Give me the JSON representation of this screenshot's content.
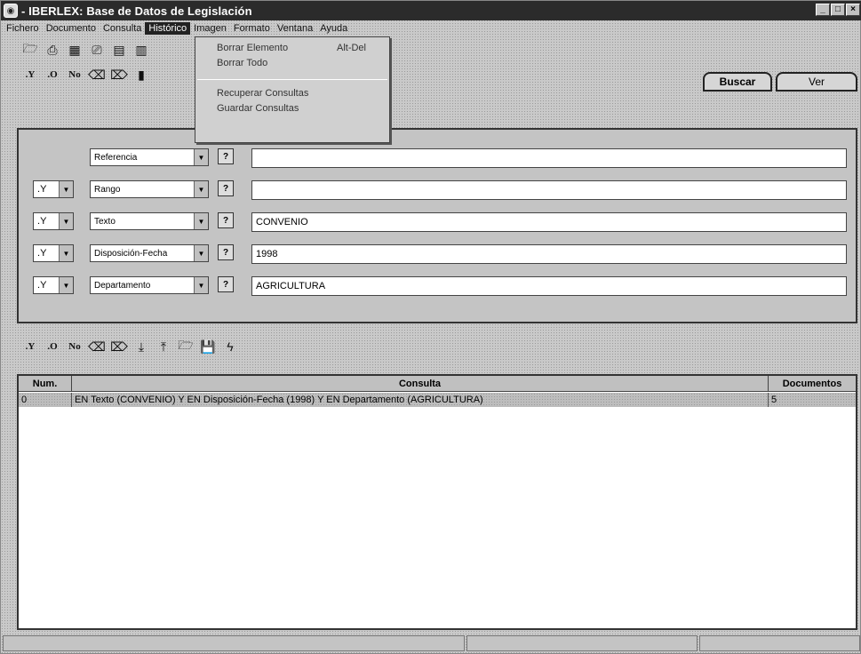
{
  "window": {
    "title": "- IBERLEX: Base de Datos de Legislación",
    "controls": [
      "_",
      "□",
      "×"
    ]
  },
  "menubar": {
    "items": [
      "Fichero",
      "Documento",
      "Consulta",
      "Histórico",
      "Imagen",
      "Formato",
      "Ventana",
      "Ayuda"
    ],
    "active": "Histórico"
  },
  "history_menu": {
    "items": [
      {
        "label": "Borrar Elemento",
        "shortcut": "Alt-Del"
      },
      {
        "label": "Borrar Todo",
        "shortcut": ""
      },
      {
        "label": "Recuperar Consultas",
        "shortcut": ""
      },
      {
        "label": "Guardar Consultas",
        "shortcut": ""
      }
    ]
  },
  "toolbar_top": {
    "row2_ops": [
      "Y",
      "O",
      "No"
    ]
  },
  "tabs": {
    "buscar": "Buscar",
    "ver": "Ver"
  },
  "query_rows": [
    {
      "operator": "",
      "field": "Referencia",
      "value": ""
    },
    {
      "operator": "Y",
      "field": "Rango",
      "value": ""
    },
    {
      "operator": "Y",
      "field": "Texto",
      "value": "CONVENIO"
    },
    {
      "operator": "Y",
      "field": "Disposición-Fecha",
      "value": "1998"
    },
    {
      "operator": "Y",
      "field": "Departamento",
      "value": "AGRICULTURA"
    }
  ],
  "toolbar_bottom": {
    "ops": [
      "Y",
      "O",
      "No"
    ]
  },
  "results": {
    "columns": [
      "Num.",
      "Consulta",
      "Documentos"
    ],
    "rows": [
      {
        "num": "0",
        "consulta": "EN Texto (CONVENIO) Y EN Disposición-Fecha (1998) Y EN Departamento (AGRICULTURA)",
        "documentos": "5"
      }
    ]
  },
  "colors": {
    "titlebar": "#2b2b2b",
    "panel_bg": "#c4c4c4",
    "input_bg": "#ffffff"
  }
}
